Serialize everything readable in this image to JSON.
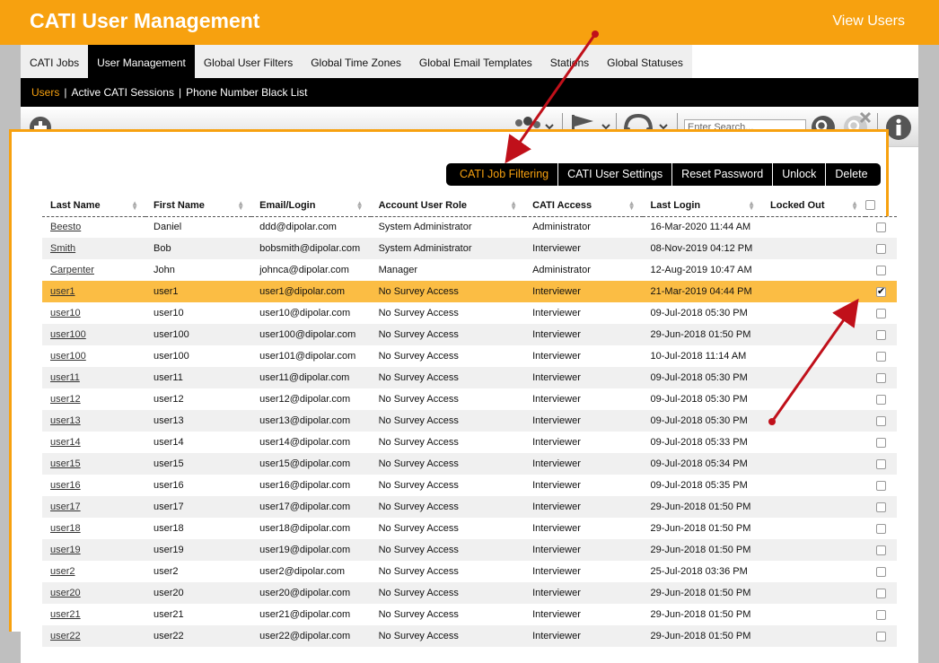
{
  "header": {
    "title": "CATI User Management",
    "view_users": "View Users"
  },
  "tabs": [
    {
      "label": "CATI Jobs",
      "active": false
    },
    {
      "label": "User Management",
      "active": true
    },
    {
      "label": "Global User Filters",
      "active": false
    },
    {
      "label": "Global Time Zones",
      "active": false
    },
    {
      "label": "Global Email Templates",
      "active": false
    },
    {
      "label": "Stations",
      "active": false
    },
    {
      "label": "Global Statuses",
      "active": false
    }
  ],
  "subnav": [
    {
      "label": "Users",
      "active": true
    },
    {
      "label": "Active CATI Sessions",
      "active": false
    },
    {
      "label": "Phone Number Black List",
      "active": false
    }
  ],
  "search": {
    "placeholder": "Enter Search..."
  },
  "actions": [
    {
      "label": "CATI Job Filtering",
      "active": true
    },
    {
      "label": "CATI User Settings",
      "active": false
    },
    {
      "label": "Reset Password",
      "active": false
    },
    {
      "label": "Unlock",
      "active": false
    },
    {
      "label": "Delete",
      "active": false
    }
  ],
  "columns": [
    "Last Name",
    "First Name",
    "Email/Login",
    "Account User Role",
    "CATI Access",
    "Last Login",
    "Locked Out"
  ],
  "rows": [
    {
      "last": "Beesto",
      "first": "Daniel",
      "email": "ddd@dipolar.com",
      "role": "System Administrator",
      "access": "Administrator",
      "login": "16-Mar-2020 11:44 AM",
      "locked": "",
      "checked": false
    },
    {
      "last": "Smith",
      "first": "Bob",
      "email": "bobsmith@dipolar.com",
      "role": "System Administrator",
      "access": "Interviewer",
      "login": "08-Nov-2019 04:12 PM",
      "locked": "",
      "checked": false
    },
    {
      "last": "Carpenter",
      "first": "John",
      "email": "johnca@dipolar.com",
      "role": "Manager",
      "access": "Administrator",
      "login": "12-Aug-2019 10:47 AM",
      "locked": "",
      "checked": false
    },
    {
      "last": "user1",
      "first": "user1",
      "email": "user1@dipolar.com",
      "role": "No Survey Access",
      "access": "Interviewer",
      "login": "21-Mar-2019 04:44 PM",
      "locked": "",
      "checked": true
    },
    {
      "last": "user10",
      "first": "user10",
      "email": "user10@dipolar.com",
      "role": "No Survey Access",
      "access": "Interviewer",
      "login": "09-Jul-2018 05:30 PM",
      "locked": "",
      "checked": false
    },
    {
      "last": "user100",
      "first": "user100",
      "email": "user100@dipolar.com",
      "role": "No Survey Access",
      "access": "Interviewer",
      "login": "29-Jun-2018 01:50 PM",
      "locked": "",
      "checked": false
    },
    {
      "last": "user100",
      "first": "user100",
      "email": "user101@dipolar.com",
      "role": "No Survey Access",
      "access": "Interviewer",
      "login": "10-Jul-2018 11:14 AM",
      "locked": "",
      "checked": false
    },
    {
      "last": "user11",
      "first": "user11",
      "email": "user11@dipolar.com",
      "role": "No Survey Access",
      "access": "Interviewer",
      "login": "09-Jul-2018 05:30 PM",
      "locked": "",
      "checked": false
    },
    {
      "last": "user12",
      "first": "user12",
      "email": "user12@dipolar.com",
      "role": "No Survey Access",
      "access": "Interviewer",
      "login": "09-Jul-2018 05:30 PM",
      "locked": "",
      "checked": false
    },
    {
      "last": "user13",
      "first": "user13",
      "email": "user13@dipolar.com",
      "role": "No Survey Access",
      "access": "Interviewer",
      "login": "09-Jul-2018 05:30 PM",
      "locked": "",
      "checked": false
    },
    {
      "last": "user14",
      "first": "user14",
      "email": "user14@dipolar.com",
      "role": "No Survey Access",
      "access": "Interviewer",
      "login": "09-Jul-2018 05:33 PM",
      "locked": "",
      "checked": false
    },
    {
      "last": "user15",
      "first": "user15",
      "email": "user15@dipolar.com",
      "role": "No Survey Access",
      "access": "Interviewer",
      "login": "09-Jul-2018 05:34 PM",
      "locked": "",
      "checked": false
    },
    {
      "last": "user16",
      "first": "user16",
      "email": "user16@dipolar.com",
      "role": "No Survey Access",
      "access": "Interviewer",
      "login": "09-Jul-2018 05:35 PM",
      "locked": "",
      "checked": false
    },
    {
      "last": "user17",
      "first": "user17",
      "email": "user17@dipolar.com",
      "role": "No Survey Access",
      "access": "Interviewer",
      "login": "29-Jun-2018 01:50 PM",
      "locked": "",
      "checked": false
    },
    {
      "last": "user18",
      "first": "user18",
      "email": "user18@dipolar.com",
      "role": "No Survey Access",
      "access": "Interviewer",
      "login": "29-Jun-2018 01:50 PM",
      "locked": "",
      "checked": false
    },
    {
      "last": "user19",
      "first": "user19",
      "email": "user19@dipolar.com",
      "role": "No Survey Access",
      "access": "Interviewer",
      "login": "29-Jun-2018 01:50 PM",
      "locked": "",
      "checked": false
    },
    {
      "last": "user2",
      "first": "user2",
      "email": "user2@dipolar.com",
      "role": "No Survey Access",
      "access": "Interviewer",
      "login": "25-Jul-2018 03:36 PM",
      "locked": "",
      "checked": false
    },
    {
      "last": "user20",
      "first": "user20",
      "email": "user20@dipolar.com",
      "role": "No Survey Access",
      "access": "Interviewer",
      "login": "29-Jun-2018 01:50 PM",
      "locked": "",
      "checked": false
    },
    {
      "last": "user21",
      "first": "user21",
      "email": "user21@dipolar.com",
      "role": "No Survey Access",
      "access": "Interviewer",
      "login": "29-Jun-2018 01:50 PM",
      "locked": "",
      "checked": false
    },
    {
      "last": "user22",
      "first": "user22",
      "email": "user22@dipolar.com",
      "role": "No Survey Access",
      "access": "Interviewer",
      "login": "29-Jun-2018 01:50 PM",
      "locked": "",
      "checked": false
    }
  ],
  "colors": {
    "accent": "#f7a10f",
    "selected_row": "#fbbd44",
    "annotation_arrow": "#c0101a"
  },
  "icons": [
    "add-icon",
    "users-filter-icon",
    "flag-filter-icon",
    "headset-filter-icon",
    "search-icon",
    "clear-search-icon",
    "info-icon"
  ]
}
